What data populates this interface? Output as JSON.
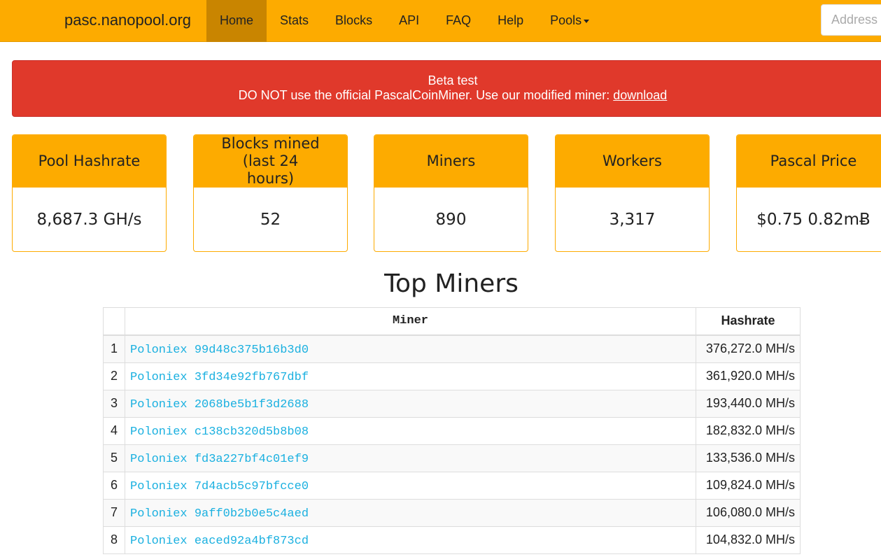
{
  "nav": {
    "brand": "pasc.nanopool.org",
    "items": [
      "Home",
      "Stats",
      "Blocks",
      "API",
      "FAQ",
      "Help",
      "Pools"
    ],
    "search_placeholder": "Address or"
  },
  "alert": {
    "line1": "Beta test",
    "line2": "DO NOT use the official PascalCoinMiner. Use our modified miner:",
    "link": "download"
  },
  "stats": [
    {
      "label": "Pool Hashrate",
      "value": "8,687.3 GH/s"
    },
    {
      "label": "Blocks mined (last 24 hours)",
      "value": "52"
    },
    {
      "label": "Miners",
      "value": "890"
    },
    {
      "label": "Workers",
      "value": "3,317"
    },
    {
      "label": "Pascal Price",
      "value": "$0.75 0.82mɃ"
    }
  ],
  "top_miners": {
    "title": "Top Miners",
    "columns": [
      "",
      "Miner",
      "Hashrate"
    ],
    "rows": [
      {
        "rank": "1",
        "miner": "Poloniex 99d48c375b16b3d0",
        "hashrate": "376,272.0 MH/s"
      },
      {
        "rank": "2",
        "miner": "Poloniex 3fd34e92fb767dbf",
        "hashrate": "361,920.0 MH/s"
      },
      {
        "rank": "3",
        "miner": "Poloniex 2068be5b1f3d2688",
        "hashrate": "193,440.0 MH/s"
      },
      {
        "rank": "4",
        "miner": "Poloniex c138cb320d5b8b08",
        "hashrate": "182,832.0 MH/s"
      },
      {
        "rank": "5",
        "miner": "Poloniex fd3a227bf4c01ef9",
        "hashrate": "133,536.0 MH/s"
      },
      {
        "rank": "6",
        "miner": "Poloniex 7d4acb5c97bfcce0",
        "hashrate": "109,824.0 MH/s"
      },
      {
        "rank": "7",
        "miner": "Poloniex 9aff0b2b0e5c4aed",
        "hashrate": "106,080.0 MH/s"
      },
      {
        "rank": "8",
        "miner": "Poloniex eaced92a4bf873cd",
        "hashrate": "104,832.0 MH/s"
      }
    ]
  },
  "colors": {
    "brand": "#fdab00",
    "alert": "#e0392b",
    "link": "#1ab0e0"
  }
}
